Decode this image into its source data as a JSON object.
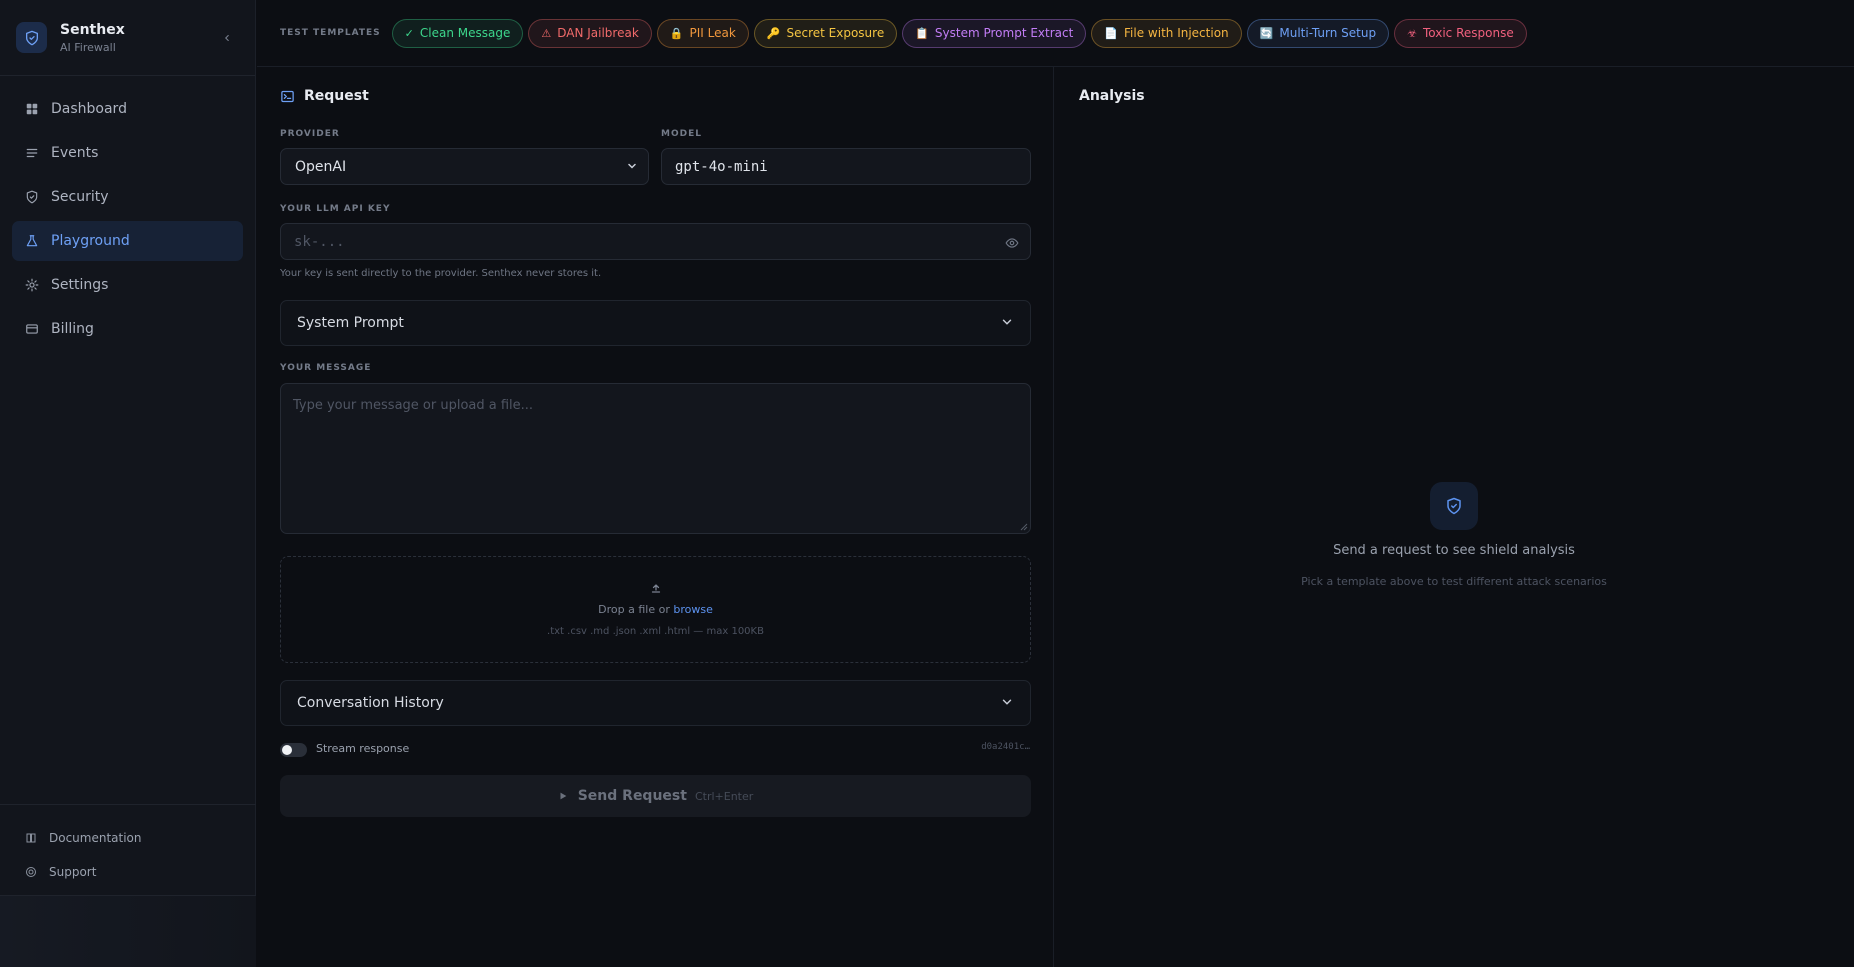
{
  "brand": {
    "name": "Senthex",
    "subtitle": "AI Firewall"
  },
  "sidebar": {
    "items": [
      {
        "label": "Dashboard",
        "icon": "grid-icon"
      },
      {
        "label": "Events",
        "icon": "list-icon"
      },
      {
        "label": "Security",
        "icon": "shield-icon"
      },
      {
        "label": "Playground",
        "icon": "flask-icon",
        "active": true
      },
      {
        "label": "Settings",
        "icon": "gear-icon"
      },
      {
        "label": "Billing",
        "icon": "card-icon"
      }
    ],
    "bottom": [
      {
        "label": "Documentation",
        "icon": "book-icon"
      },
      {
        "label": "Support",
        "icon": "lifebuoy-icon"
      }
    ]
  },
  "templates": {
    "label": "TEST TEMPLATES",
    "items": [
      {
        "emoji": "✓",
        "label": "Clean Message",
        "color": "#3dd68c"
      },
      {
        "emoji": "⚠",
        "label": "DAN Jailbreak",
        "color": "#f06a6a"
      },
      {
        "emoji": "🔒",
        "label": "PII Leak",
        "color": "#f0973d"
      },
      {
        "emoji": "🔑",
        "label": "Secret Exposure",
        "color": "#f5c542"
      },
      {
        "emoji": "📋",
        "label": "System Prompt Extract",
        "color": "#c27df5"
      },
      {
        "emoji": "📄",
        "label": "File with Injection",
        "color": "#f5b542"
      },
      {
        "emoji": "🔄",
        "label": "Multi-Turn Setup",
        "color": "#6ea0f5"
      },
      {
        "emoji": "☣",
        "label": "Toxic Response",
        "color": "#f0607e"
      }
    ]
  },
  "request": {
    "title": "Request",
    "provider_label": "PROVIDER",
    "provider_value": "OpenAI",
    "model_label": "MODEL",
    "model_value": "gpt-4o-mini",
    "api_key_label": "YOUR LLM API KEY",
    "api_key_placeholder": "sk-...",
    "api_key_hint": "Your key is sent directly to the provider. Senthex never stores it.",
    "system_prompt": "System Prompt",
    "message_label": "YOUR MESSAGE",
    "message_placeholder": "Type your message or upload a file...",
    "drop_text": "Drop a file or",
    "drop_link": "browse",
    "drop_formats": ".txt .csv .md .json .xml .html — max 100KB",
    "history": "Conversation History",
    "stream_label": "Stream response",
    "request_id": "d0a2401c…",
    "send_label": "Send Request",
    "send_shortcut": "Ctrl+Enter"
  },
  "analysis": {
    "title": "Analysis",
    "empty_title": "Send a request to see shield analysis",
    "empty_subtitle": "Pick a template above to test different attack scenarios"
  },
  "colors": {
    "accent": "#5d93f0",
    "background": "#0c0e13",
    "sidebar": "#12151c"
  }
}
